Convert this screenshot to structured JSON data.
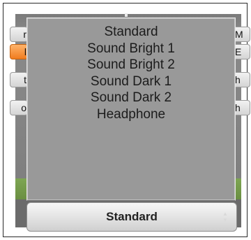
{
  "background_buttons": {
    "left": [
      "r",
      "l",
      "t",
      "o"
    ],
    "right": [
      "M",
      "E",
      "h",
      "h"
    ]
  },
  "popup": {
    "options": [
      "Standard",
      "Sound Bright 1",
      "Sound Bright 2",
      "Sound Dark 1",
      "Sound Dark 2",
      "Headphone"
    ]
  },
  "select": {
    "value": "Standard",
    "arrows_icon": "up-down-chevron-icon"
  },
  "colors": {
    "popup_bg": "#999999",
    "highlight_orange": "#f07c1e",
    "grass": "#6a8f42"
  }
}
